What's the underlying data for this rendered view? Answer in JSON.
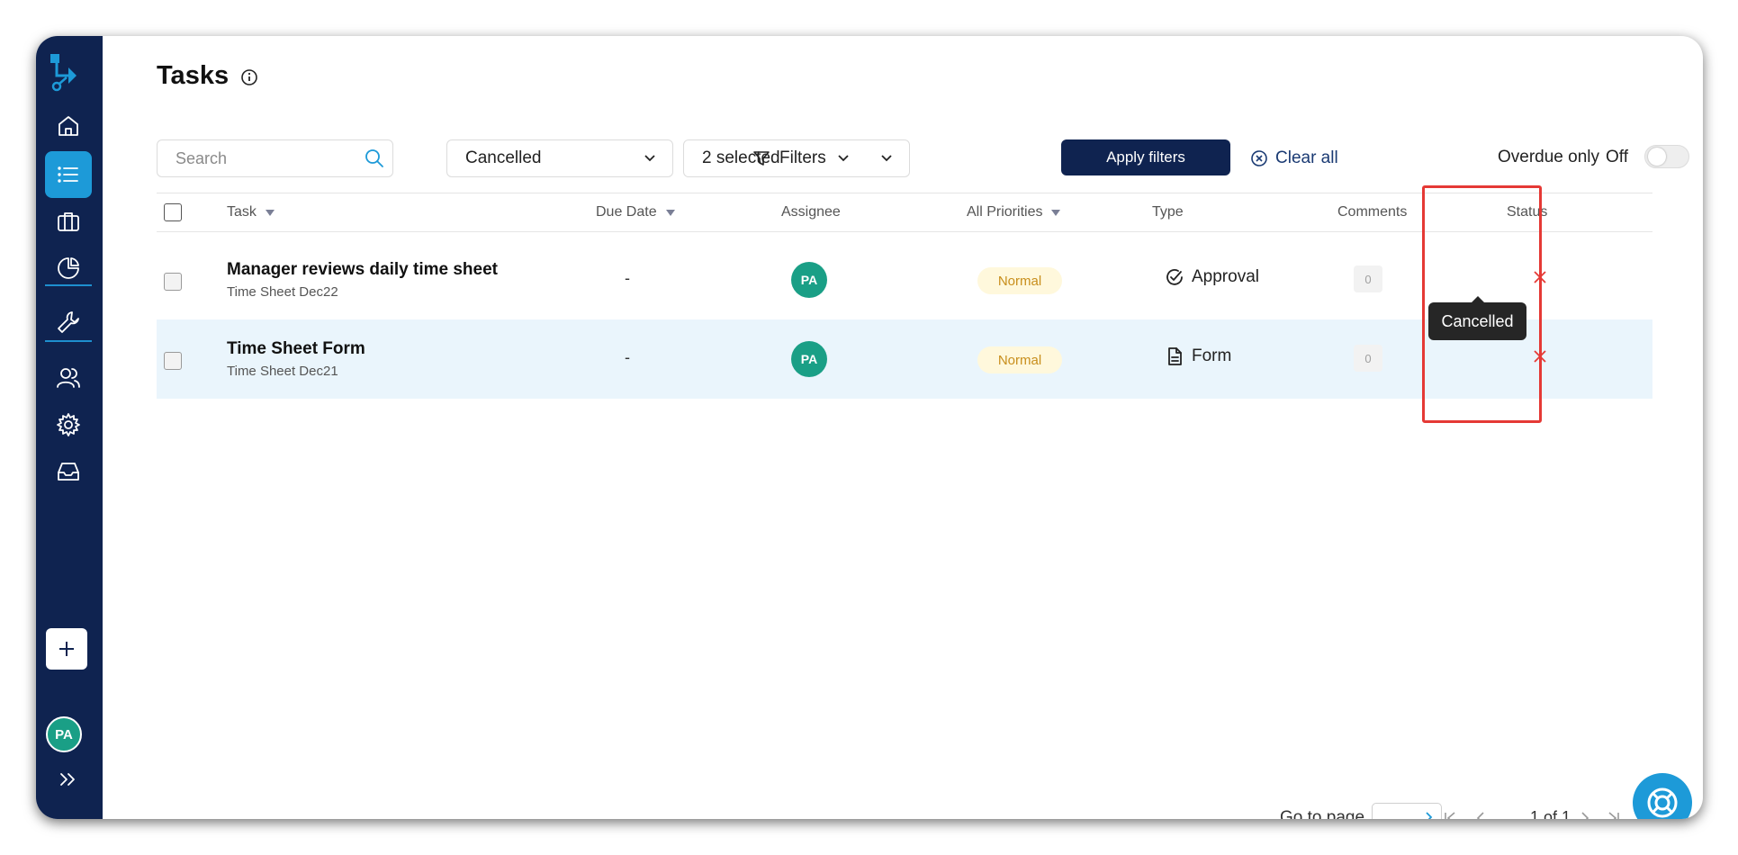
{
  "sidebar": {
    "items": [
      {
        "name": "home-icon"
      },
      {
        "name": "tasks-list-icon",
        "active": true
      },
      {
        "name": "briefcase-icon"
      },
      {
        "name": "pie-chart-icon"
      },
      {
        "name": "wrench-icon"
      },
      {
        "name": "users-icon"
      },
      {
        "name": "gear-icon"
      },
      {
        "name": "inbox-icon"
      }
    ],
    "avatar_initials": "PA",
    "expand_icon": "double-chevron-right-icon"
  },
  "header": {
    "title": "Tasks"
  },
  "toolbar": {
    "search_placeholder": "Search",
    "status_filter": "Cancelled",
    "multi_filter": "2 selected",
    "filters_label": "Filters",
    "apply_label": "Apply filters",
    "clear_label": "Clear all",
    "overdue_label": "Overdue only",
    "overdue_state": "Off"
  },
  "table": {
    "columns": [
      "Task",
      "Due Date",
      "Assignee",
      "All Priorities",
      "Type",
      "Comments",
      "Status"
    ],
    "rows": [
      {
        "title": "Manager reviews daily time sheet",
        "subtitle": "Time Sheet Dec22",
        "due": "-",
        "assignee": "PA",
        "priority": "Normal",
        "type": "Approval",
        "type_icon": "check-circle-icon",
        "comments": "0",
        "status_icon": "x-icon"
      },
      {
        "title": "Time Sheet Form",
        "subtitle": "Time Sheet Dec21",
        "due": "-",
        "assignee": "PA",
        "priority": "Normal",
        "type": "Form",
        "type_icon": "document-icon",
        "comments": "0",
        "status_icon": "x-icon"
      }
    ]
  },
  "tooltip": {
    "text": "Cancelled"
  },
  "pagination": {
    "go_label": "Go to page",
    "page_info": "1 of 1"
  },
  "colors": {
    "sidebar_bg": "#0f2350",
    "accent": "#1d9ad8",
    "primary_button": "#0f2350",
    "status_cancelled": "#e53935",
    "highlight_box": "#e53935",
    "priority_text": "#c88e1c",
    "avatar_bg": "#1a9f86"
  }
}
